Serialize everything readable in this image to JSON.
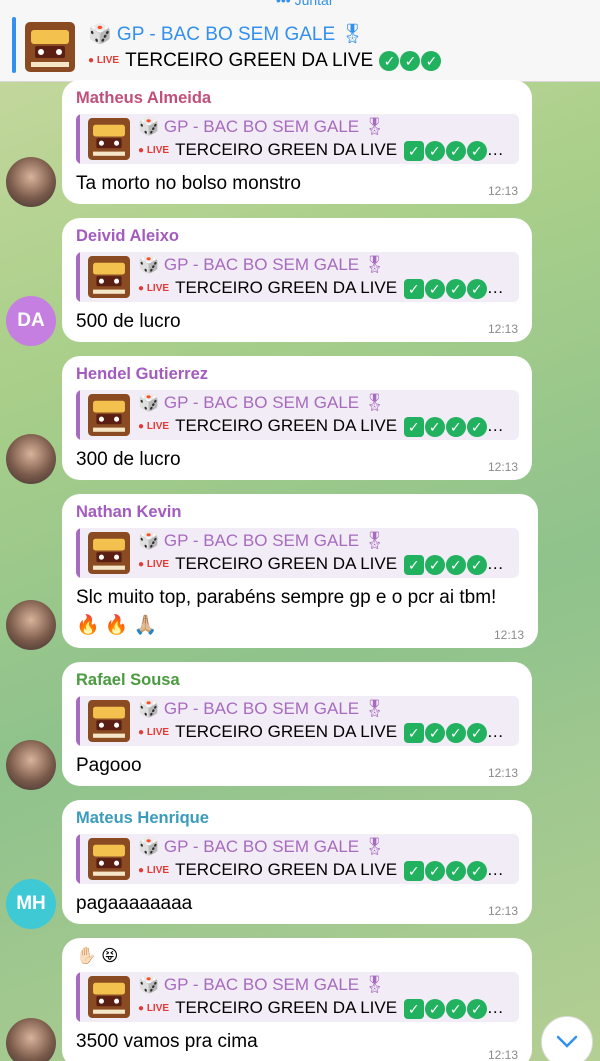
{
  "pinned": {
    "join_label": "••• Juntar",
    "title": "🎲 GP - BAC BO SEM GALE 🎖",
    "live_label": "LIVE",
    "text": "TERCEIRO GREEN DA LIVE"
  },
  "reply": {
    "title": "🎲 GP - BAC BO SEM GALE 🎖",
    "live_label": "LIVE",
    "text": "TERCEIRO GREEN DA LIVE"
  },
  "colors": {
    "accent": "#3390ec",
    "reply_purple": "#a66bbf",
    "green_check": "#21b15f"
  },
  "messages": [
    {
      "sender": "Matheus Almeida",
      "sender_color": "#c0507a",
      "text": "Ta morto no bolso monstro",
      "time": "12:13",
      "avatar": "photo"
    },
    {
      "sender": "Deivid Aleixo",
      "sender_color": "#a35bbf",
      "text": "500 de lucro",
      "time": "12:13",
      "avatar_initials": "DA",
      "avatar_color": "#c47fe0"
    },
    {
      "sender": "Hendel Gutierrez",
      "sender_color": "#a35bbf",
      "text": "300 de lucro",
      "time": "12:13",
      "avatar": "photo"
    },
    {
      "sender": "Nathan Kevin",
      "sender_color": "#a35bbf",
      "text": "Slc muito top, parabéns sempre gp e o pcr ai tbm! 🔥 🔥 🙏🏼",
      "time": "12:13",
      "avatar": "photo"
    },
    {
      "sender": "Rafael Sousa",
      "sender_color": "#4a9a3f",
      "text": "Pagooo",
      "time": "12:13",
      "avatar": "photo"
    },
    {
      "sender": "Mateus Henrique",
      "sender_color": "#3a9bbd",
      "text": "pagaaaaaaaa",
      "time": "12:13",
      "avatar_initials": "MH",
      "avatar_color": "#3fc9d4"
    },
    {
      "sender": "✋🏻 😝",
      "sender_color": "#000000",
      "text": "3500 vamos pra cima",
      "time": "12:13",
      "avatar": "photo"
    }
  ]
}
